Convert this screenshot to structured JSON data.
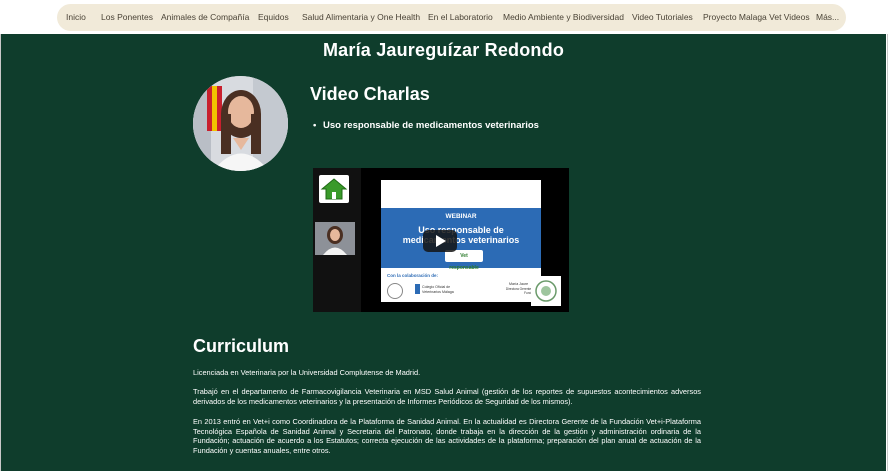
{
  "nav": {
    "items": [
      "Inicio",
      "Los Ponentes",
      "Animales de Compañía",
      "Equidos",
      "Salud Alimentaria y One Health",
      "En el Laboratorio",
      "Medio Ambiente y Biodiversidad",
      "Video Tutoriales",
      "Proyecto Malaga Vet Videos",
      "Más..."
    ]
  },
  "speaker": {
    "name": "María Jaureguízar Redondo"
  },
  "talks": {
    "title": "Video Charlas",
    "items": [
      "Uso responsable de medicamentos veterinarios"
    ]
  },
  "video": {
    "slide_label": "WEBINAR",
    "slide_title_line1": "Uso responsable de",
    "slide_title_line2": "medicamentos veterinarios",
    "logo_text": "Vet responsable",
    "collab_text": "Con la colaboración de:",
    "org_name": "Colegio Oficial de Veterinarios Málaga",
    "presenter_name": "María Jaure",
    "presenter_role": "Directora Gerente de la Fundación"
  },
  "curriculum": {
    "title": "Curriculum",
    "paragraphs": [
      "Licenciada en Veterinaria por la Universidad Complutense de Madrid.",
      "Trabajó en el departamento de Farmacovigilancia Veterinaria en MSD Salud Animal (gestión de los reportes de supuestos acontecimientos adversos derivados de los medicamentos veterinarios y la presentación de Informes Periódicos de Seguridad de los mismos).",
      "En 2013 entró en Vet+i como Coordinadora de la Plataforma de Sanidad Animal. En la actualidad es Directora Gerente de la Fundación Vet+i-Plataforma Tecnológica Española de Sanidad Animal y Secretaria del Patronato, donde trabaja en la dirección de la gestión y administración ordinaria de la Fundación; actuación de acuerdo a los Estatutos; correcta ejecución de las actividades de la plataforma; preparación del plan anual de actuación de la Fundación y cuentas anuales, entre otros."
    ]
  },
  "colors": {
    "page_bg": "#0f3d2c",
    "nav_bg": "#f1ead9",
    "slide_blue": "#2c6bb5"
  }
}
